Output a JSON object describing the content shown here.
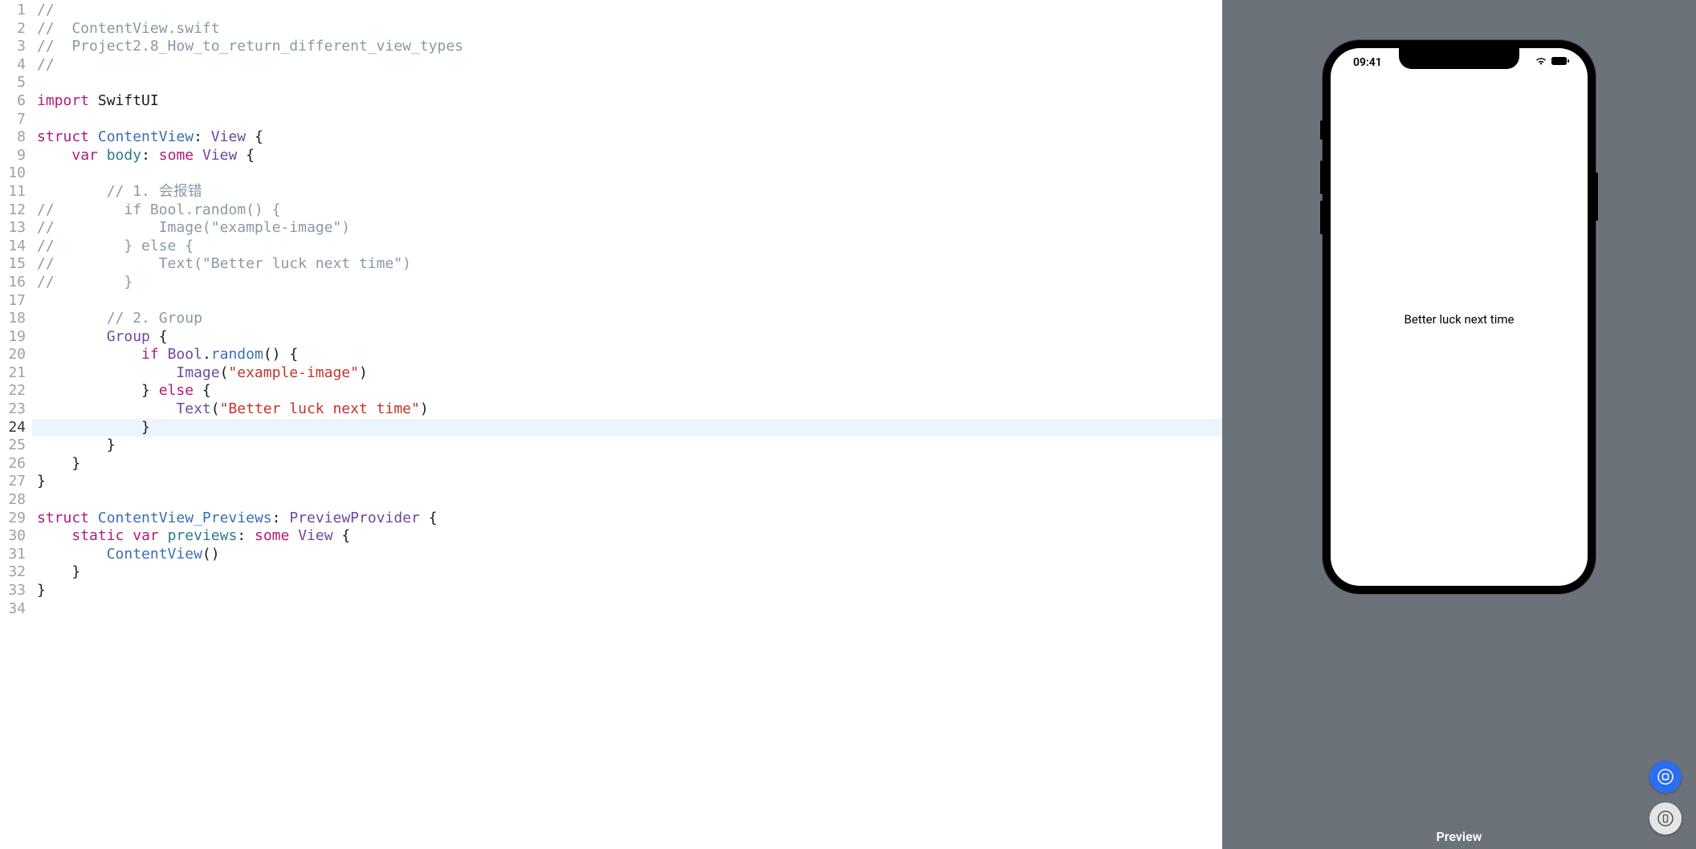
{
  "editor": {
    "current_line": 24,
    "lines": [
      {
        "n": 1,
        "tokens": [
          {
            "c": "tok-comment",
            "t": "//"
          }
        ]
      },
      {
        "n": 2,
        "tokens": [
          {
            "c": "tok-comment",
            "t": "//  ContentView.swift"
          }
        ]
      },
      {
        "n": 3,
        "tokens": [
          {
            "c": "tok-comment",
            "t": "//  Project2.8_How_to_return_different_view_types"
          }
        ]
      },
      {
        "n": 4,
        "tokens": [
          {
            "c": "tok-comment",
            "t": "//"
          }
        ]
      },
      {
        "n": 5,
        "tokens": []
      },
      {
        "n": 6,
        "tokens": [
          {
            "c": "tok-keyword",
            "t": "import"
          },
          {
            "c": "tok-plain",
            "t": " SwiftUI"
          }
        ]
      },
      {
        "n": 7,
        "tokens": []
      },
      {
        "n": 8,
        "tokens": [
          {
            "c": "tok-keyword",
            "t": "struct"
          },
          {
            "c": "tok-plain",
            "t": " "
          },
          {
            "c": "tok-type",
            "t": "ContentView"
          },
          {
            "c": "tok-plain",
            "t": ": "
          },
          {
            "c": "tok-type2",
            "t": "View"
          },
          {
            "c": "tok-plain",
            "t": " {"
          }
        ]
      },
      {
        "n": 9,
        "tokens": [
          {
            "c": "tok-plain",
            "t": "    "
          },
          {
            "c": "tok-keyword",
            "t": "var"
          },
          {
            "c": "tok-plain",
            "t": " "
          },
          {
            "c": "tok-ident",
            "t": "body"
          },
          {
            "c": "tok-plain",
            "t": ": "
          },
          {
            "c": "tok-keyword",
            "t": "some"
          },
          {
            "c": "tok-plain",
            "t": " "
          },
          {
            "c": "tok-type2",
            "t": "View"
          },
          {
            "c": "tok-plain",
            "t": " {"
          }
        ]
      },
      {
        "n": 10,
        "tokens": []
      },
      {
        "n": 11,
        "tokens": [
          {
            "c": "tok-plain",
            "t": "        "
          },
          {
            "c": "tok-comment",
            "t": "// 1. 会报错"
          }
        ]
      },
      {
        "n": 12,
        "tokens": [
          {
            "c": "tok-comment",
            "t": "//        if Bool.random() {"
          }
        ]
      },
      {
        "n": 13,
        "tokens": [
          {
            "c": "tok-comment",
            "t": "//            Image(\"example-image\")"
          }
        ]
      },
      {
        "n": 14,
        "tokens": [
          {
            "c": "tok-comment",
            "t": "//        } else {"
          }
        ]
      },
      {
        "n": 15,
        "tokens": [
          {
            "c": "tok-comment",
            "t": "//            Text(\"Better luck next time\")"
          }
        ]
      },
      {
        "n": 16,
        "tokens": [
          {
            "c": "tok-comment",
            "t": "//        }"
          }
        ]
      },
      {
        "n": 17,
        "tokens": []
      },
      {
        "n": 18,
        "tokens": [
          {
            "c": "tok-plain",
            "t": "        "
          },
          {
            "c": "tok-comment",
            "t": "// 2. Group"
          }
        ]
      },
      {
        "n": 19,
        "tokens": [
          {
            "c": "tok-plain",
            "t": "        "
          },
          {
            "c": "tok-type2",
            "t": "Group"
          },
          {
            "c": "tok-plain",
            "t": " {"
          }
        ]
      },
      {
        "n": 20,
        "tokens": [
          {
            "c": "tok-plain",
            "t": "            "
          },
          {
            "c": "tok-keyword",
            "t": "if"
          },
          {
            "c": "tok-plain",
            "t": " "
          },
          {
            "c": "tok-type2",
            "t": "Bool"
          },
          {
            "c": "tok-plain",
            "t": "."
          },
          {
            "c": "tok-func",
            "t": "random"
          },
          {
            "c": "tok-plain",
            "t": "() {"
          }
        ]
      },
      {
        "n": 21,
        "tokens": [
          {
            "c": "tok-plain",
            "t": "                "
          },
          {
            "c": "tok-type2",
            "t": "Image"
          },
          {
            "c": "tok-plain",
            "t": "("
          },
          {
            "c": "tok-string",
            "t": "\"example-image\""
          },
          {
            "c": "tok-plain",
            "t": ")"
          }
        ]
      },
      {
        "n": 22,
        "tokens": [
          {
            "c": "tok-plain",
            "t": "            } "
          },
          {
            "c": "tok-keyword",
            "t": "else"
          },
          {
            "c": "tok-plain",
            "t": " {"
          }
        ]
      },
      {
        "n": 23,
        "tokens": [
          {
            "c": "tok-plain",
            "t": "                "
          },
          {
            "c": "tok-type2",
            "t": "Text"
          },
          {
            "c": "tok-plain",
            "t": "("
          },
          {
            "c": "tok-string",
            "t": "\"Better luck next time\""
          },
          {
            "c": "tok-plain",
            "t": ")"
          }
        ]
      },
      {
        "n": 24,
        "tokens": [
          {
            "c": "tok-plain",
            "t": "            }"
          }
        ]
      },
      {
        "n": 25,
        "tokens": [
          {
            "c": "tok-plain",
            "t": "        }"
          }
        ]
      },
      {
        "n": 26,
        "tokens": [
          {
            "c": "tok-plain",
            "t": "    }"
          }
        ]
      },
      {
        "n": 27,
        "tokens": [
          {
            "c": "tok-plain",
            "t": "}"
          }
        ]
      },
      {
        "n": 28,
        "tokens": []
      },
      {
        "n": 29,
        "tokens": [
          {
            "c": "tok-keyword",
            "t": "struct"
          },
          {
            "c": "tok-plain",
            "t": " "
          },
          {
            "c": "tok-type",
            "t": "ContentView_Previews"
          },
          {
            "c": "tok-plain",
            "t": ": "
          },
          {
            "c": "tok-type2",
            "t": "PreviewProvider"
          },
          {
            "c": "tok-plain",
            "t": " {"
          }
        ]
      },
      {
        "n": 30,
        "tokens": [
          {
            "c": "tok-plain",
            "t": "    "
          },
          {
            "c": "tok-keyword",
            "t": "static"
          },
          {
            "c": "tok-plain",
            "t": " "
          },
          {
            "c": "tok-keyword",
            "t": "var"
          },
          {
            "c": "tok-plain",
            "t": " "
          },
          {
            "c": "tok-ident",
            "t": "previews"
          },
          {
            "c": "tok-plain",
            "t": ": "
          },
          {
            "c": "tok-keyword",
            "t": "some"
          },
          {
            "c": "tok-plain",
            "t": " "
          },
          {
            "c": "tok-type2",
            "t": "View"
          },
          {
            "c": "tok-plain",
            "t": " {"
          }
        ]
      },
      {
        "n": 31,
        "tokens": [
          {
            "c": "tok-plain",
            "t": "        "
          },
          {
            "c": "tok-type",
            "t": "ContentView"
          },
          {
            "c": "tok-plain",
            "t": "()"
          }
        ]
      },
      {
        "n": 32,
        "tokens": [
          {
            "c": "tok-plain",
            "t": "    }"
          }
        ]
      },
      {
        "n": 33,
        "tokens": [
          {
            "c": "tok-plain",
            "t": "}"
          }
        ]
      },
      {
        "n": 34,
        "tokens": []
      }
    ]
  },
  "preview": {
    "label": "Preview",
    "time": "09:41",
    "content_text": "Better luck next time"
  }
}
